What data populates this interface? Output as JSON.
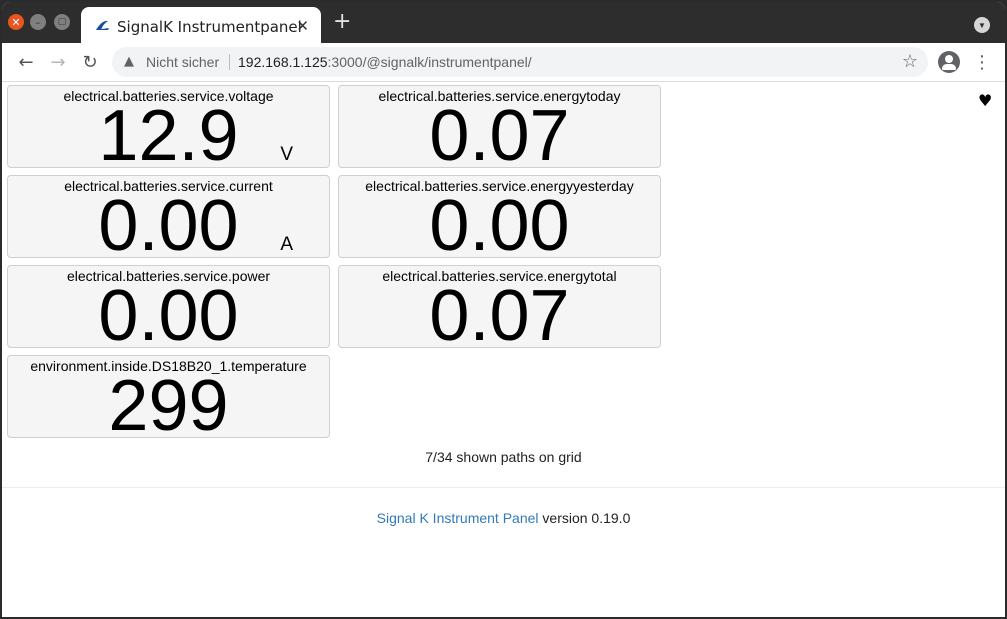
{
  "browser": {
    "tab_title": "SignalK Instrumentpanel",
    "tab_close": "✕",
    "new_tab": "+",
    "security_label": "Nicht sicher",
    "url_host": "192.168.1.125",
    "url_path": ":3000/@signalk/instrumentpanel/",
    "icons": {
      "back": "arrow-left-icon",
      "forward": "arrow-right-icon",
      "reload": "reload-icon",
      "warning": "warning-triangle-icon",
      "bookmark": "star-icon",
      "profile": "account-icon",
      "menu": "kebab-menu-icon"
    },
    "colors": {
      "close_button": "#e95420",
      "tabbar": "#2d2d2d"
    }
  },
  "panel": {
    "favorite_icon": "heart-icon",
    "cells": [
      {
        "title": "electrical.batteries.service.voltage",
        "value": "12.9",
        "unit": "V"
      },
      {
        "title": "electrical.batteries.service.energytoday",
        "value": "0.07",
        "unit": ""
      },
      {
        "title": "electrical.batteries.service.current",
        "value": "0.00",
        "unit": "A"
      },
      {
        "title": "electrical.batteries.service.energyyesterday",
        "value": "0.00",
        "unit": ""
      },
      {
        "title": "electrical.batteries.service.power",
        "value": "0.00",
        "unit": ""
      },
      {
        "title": "electrical.batteries.service.energytotal",
        "value": "0.07",
        "unit": ""
      },
      {
        "title": "environment.inside.DS18B20_1.temperature",
        "value": "299",
        "unit": ""
      }
    ],
    "paths_info": "7/34 shown paths on grid"
  },
  "footer": {
    "link_text": "Signal K Instrument Panel",
    "version_text": " version 0.19.0",
    "link_color": "#337ab7"
  }
}
